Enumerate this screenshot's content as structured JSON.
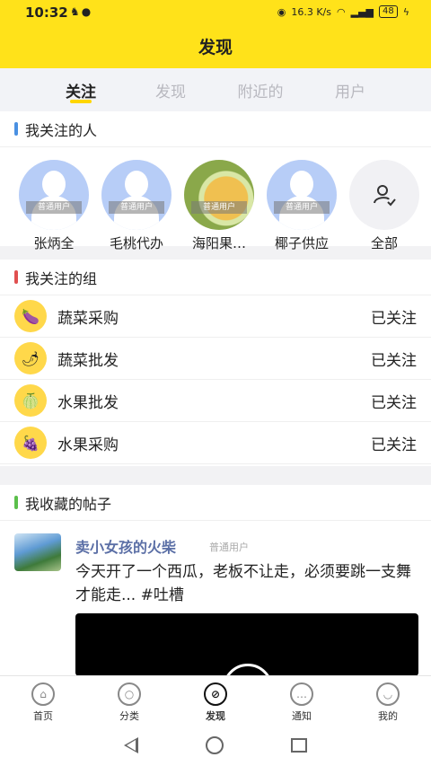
{
  "status_bar": {
    "time": "10:32",
    "left_icons": "♞●",
    "speed": "16.3 K/s",
    "battery": "48"
  },
  "header": {
    "title": "发现"
  },
  "tabs": [
    {
      "label": "关注",
      "active": true
    },
    {
      "label": "发现",
      "active": false
    },
    {
      "label": "附近的",
      "active": false
    },
    {
      "label": "用户",
      "active": false
    }
  ],
  "followed_people": {
    "title": "我关注的人",
    "accent": "#4a90e2",
    "people": [
      {
        "name": "张炳全",
        "tag": "普通用户"
      },
      {
        "name": "毛桃代办",
        "tag": "普通用户"
      },
      {
        "name": "海阳果…",
        "tag": "普通用户"
      },
      {
        "name": "椰子供应",
        "tag": "普通用户"
      }
    ],
    "all_label": "全部"
  },
  "followed_groups": {
    "title": "我关注的组",
    "accent": "#e05050",
    "groups": [
      {
        "name": "蔬菜采购",
        "status": "已关注",
        "icon": "eggplant-icon"
      },
      {
        "name": "蔬菜批发",
        "status": "已关注",
        "icon": "pepper-icon"
      },
      {
        "name": "水果批发",
        "status": "已关注",
        "icon": "fruit-icon"
      },
      {
        "name": "水果采购",
        "status": "已关注",
        "icon": "grape-icon"
      }
    ]
  },
  "saved_posts": {
    "title": "我收藏的帖子",
    "accent": "#5bbf4b",
    "posts": [
      {
        "author": "卖小女孩的火柴",
        "role": "普通用户",
        "text": "今天开了一个西瓜，老板不让走，必须要跳一支舞才能走... #吐槽"
      }
    ]
  },
  "bottom_nav": [
    {
      "label": "首页",
      "icon": "home-icon",
      "active": false
    },
    {
      "label": "分类",
      "icon": "category-icon",
      "active": false
    },
    {
      "label": "发现",
      "icon": "compass-icon",
      "active": true
    },
    {
      "label": "通知",
      "icon": "message-icon",
      "active": false
    },
    {
      "label": "我的",
      "icon": "profile-icon",
      "active": false
    }
  ]
}
